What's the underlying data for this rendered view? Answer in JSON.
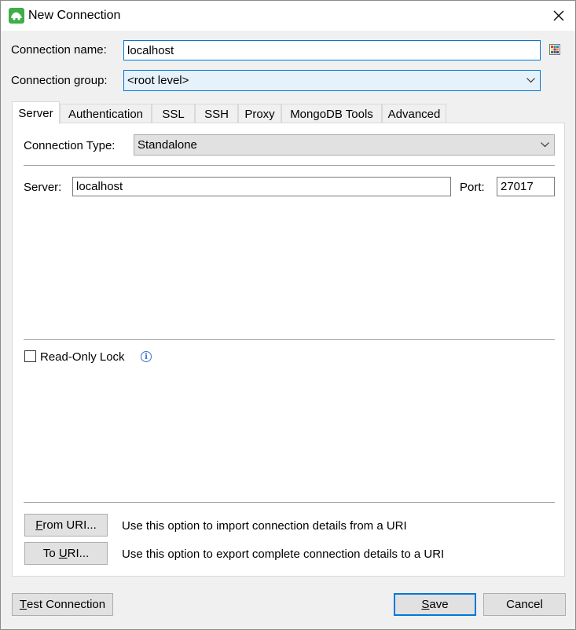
{
  "window": {
    "title": "New Connection"
  },
  "connection_name": {
    "label": "Connection name:",
    "value": "localhost"
  },
  "connection_group": {
    "label": "Connection group:",
    "value": "<root level>"
  },
  "tabs": [
    {
      "label": "Server",
      "active": true
    },
    {
      "label": "Authentication"
    },
    {
      "label": "SSL"
    },
    {
      "label": "SSH"
    },
    {
      "label": "Proxy"
    },
    {
      "label": "MongoDB Tools"
    },
    {
      "label": "Advanced"
    }
  ],
  "server_tab": {
    "connection_type_label": "Connection Type:",
    "connection_type_value": "Standalone",
    "server_label": "Server:",
    "server_value": "localhost",
    "port_label": "Port:",
    "port_value": "27017",
    "read_only_label": "Read-Only Lock",
    "read_only_checked": false,
    "info_glyph": "i",
    "from_uri_button_first": "F",
    "from_uri_button_rest": "rom URI...",
    "from_uri_desc": "Use this option to import connection details from a URI",
    "to_uri_button_pre": "To ",
    "to_uri_button_u": "U",
    "to_uri_button_rest": "RI...",
    "to_uri_desc": "Use this option to export complete connection details to a URI"
  },
  "footer": {
    "test_first": "T",
    "test_rest": "est Connection",
    "save_first": "S",
    "save_rest": "ave",
    "cancel": "Cancel"
  },
  "colors": {
    "focus": "#0078d7",
    "app_icon": "#3fae49",
    "info": "#3b6fd6"
  }
}
